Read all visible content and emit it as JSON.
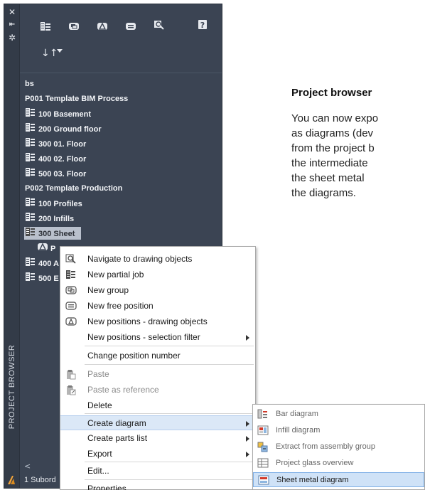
{
  "palette": {
    "vertical_title": "PROJECT BROWSER",
    "tree": {
      "root": "bs",
      "items": [
        {
          "label": "P001 Template BIM Process",
          "icon": "project",
          "level": 0
        },
        {
          "label": "100 Basement",
          "icon": "partial-job-icon",
          "level": 1
        },
        {
          "label": "200 Ground floor",
          "icon": "partial-job-icon",
          "level": 1
        },
        {
          "label": "300 01. Floor",
          "icon": "partial-job-icon",
          "level": 1
        },
        {
          "label": "400 02. Floor",
          "icon": "partial-job-icon",
          "level": 1
        },
        {
          "label": "500 03. Floor",
          "icon": "partial-job-icon",
          "level": 1
        },
        {
          "label": "P002 Template Production",
          "icon": "project",
          "level": 0
        },
        {
          "label": "100 Profiles",
          "icon": "partial-job-icon",
          "level": 1
        },
        {
          "label": "200 Infills",
          "icon": "partial-job-icon",
          "level": 1
        },
        {
          "label": "300 Sheet",
          "icon": "partial-job-icon",
          "level": 1,
          "selected": true
        },
        {
          "label": "P",
          "icon": "position-icon",
          "level": 2
        },
        {
          "label": "400 A",
          "icon": "partial-job-icon",
          "level": 1
        },
        {
          "label": "500 E",
          "icon": "partial-job-icon",
          "level": 1
        }
      ]
    },
    "hscroll_arrow": "<",
    "status": "1 Subord"
  },
  "doc": {
    "heading": "Project browser",
    "lines": [
      "You can now expo",
      "as  diagrams  (dev",
      "from  the  project  b",
      "the  intermediate",
      "the  sheet  metal",
      "the diagrams."
    ]
  },
  "context_menu": {
    "items": [
      {
        "label": "Navigate to drawing objects",
        "icon": "navigate-icon"
      },
      {
        "label": "New partial job",
        "icon": "partial-job-icon"
      },
      {
        "label": "New group",
        "icon": "group-icon"
      },
      {
        "label": "New free position",
        "icon": "free-position-icon"
      },
      {
        "label": "New positions - drawing objects",
        "icon": "positions-drawing-icon"
      },
      {
        "label": "New positions - selection filter",
        "submenu": true
      },
      {
        "label": "Change position number"
      },
      {
        "label": "Paste",
        "icon": "paste-icon",
        "disabled": true
      },
      {
        "label": "Paste as reference",
        "icon": "paste-reference-icon",
        "disabled": true
      },
      {
        "label": "Delete"
      },
      {
        "label": "Create diagram",
        "submenu": true,
        "hover": true
      },
      {
        "label": "Create parts list",
        "submenu": true
      },
      {
        "label": "Export",
        "submenu": true
      },
      {
        "label": "Edit..."
      },
      {
        "label": "Properties"
      }
    ]
  },
  "sub_menu": {
    "items": [
      {
        "label": "Bar diagram",
        "icon": "bar-diagram-icon"
      },
      {
        "label": "Infill diagram",
        "icon": "infill-diagram-icon"
      },
      {
        "label": "Extract from assembly group",
        "icon": "assembly-extract-icon"
      },
      {
        "label": "Project glass overview",
        "icon": "glass-overview-icon"
      },
      {
        "label": "Sheet metal diagram",
        "icon": "sheet-metal-diagram-icon",
        "active": true
      }
    ]
  },
  "colors": {
    "palette_bg": "#3b4453",
    "menu_hover": "#dbe8f7",
    "submenu_active": "#cfe2f7"
  }
}
